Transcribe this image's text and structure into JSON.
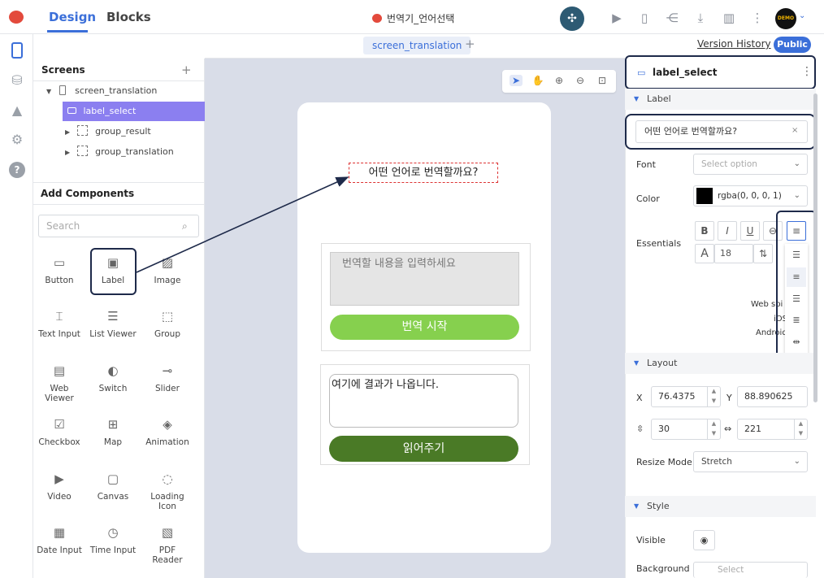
{
  "topbar": {
    "tab_design": "Design",
    "tab_blocks": "Blocks",
    "app_title": "번역기_언어선택",
    "avatar_text": "DEMO"
  },
  "tabstrip": {
    "screen_tab": "screen_translation",
    "add": "+",
    "version_history": "Version History",
    "public": "Public"
  },
  "screens": {
    "header": "Screens",
    "add": "+",
    "items": [
      {
        "label": "screen_translation"
      },
      {
        "label": "label_select"
      },
      {
        "label": "group_result"
      },
      {
        "label": "group_translation"
      }
    ]
  },
  "add_components": {
    "header": "Add Components",
    "search_placeholder": "Search",
    "items": [
      {
        "label": "Button",
        "icon": "button-icon"
      },
      {
        "label": "Label",
        "icon": "label-icon"
      },
      {
        "label": "Image",
        "icon": "image-icon"
      },
      {
        "label": "Text Input",
        "icon": "text-input-icon"
      },
      {
        "label": "List Viewer",
        "icon": "list-icon"
      },
      {
        "label": "Group",
        "icon": "group-icon"
      },
      {
        "label": "Web\nViewer",
        "icon": "web-viewer-icon"
      },
      {
        "label": "Switch",
        "icon": "switch-icon"
      },
      {
        "label": "Slider",
        "icon": "slider-icon"
      },
      {
        "label": "Checkbox",
        "icon": "checkbox-icon"
      },
      {
        "label": "Map",
        "icon": "map-icon"
      },
      {
        "label": "Animation",
        "icon": "animation-icon"
      },
      {
        "label": "Video",
        "icon": "video-icon"
      },
      {
        "label": "Canvas",
        "icon": "canvas-icon"
      },
      {
        "label": "Loading\nIcon",
        "icon": "loading-icon"
      },
      {
        "label": "Date Input",
        "icon": "calendar-icon"
      },
      {
        "label": "Time Input",
        "icon": "clock-icon"
      },
      {
        "label": "PDF\nReader",
        "icon": "pdf-icon"
      }
    ]
  },
  "phone": {
    "label_text": "어떤 언어로 번역할까요?",
    "input_placeholder": "번역할 내용을 입력하세요",
    "start_button": "번역 시작",
    "result_text": "여기에 결과가 나옵니다.",
    "read_button": "읽어주기"
  },
  "properties": {
    "title": "label_select",
    "section_label": "Label",
    "label_value": "어떤 언어로 번역할까요?",
    "clear": "×",
    "font_label": "Font",
    "font_placeholder": "Select option",
    "color_label": "Color",
    "color_value": "rgba(0, 0, 0, 1)",
    "essentials_label": "Essentials",
    "font_size": "18",
    "note_web": "Web spi",
    "note_ios": "iOS",
    "note_android": "Android",
    "section_layout": "Layout",
    "x_label": "X",
    "x_value": "76.4375",
    "y_label": "Y",
    "y_value": "88.890625",
    "height_value": "30",
    "width_value": "221",
    "resize_label": "Resize Mode",
    "resize_value": "Stretch",
    "section_style": "Style",
    "visible_label": "Visible",
    "background_label": "Background",
    "background_placeholder": "Select"
  },
  "colors": {
    "accent": "#3b6fd9",
    "selected_row": "#8b7ff0",
    "start_button": "#86d04e",
    "read_button": "#4a7a26",
    "highlight": "#1e2a4a"
  }
}
